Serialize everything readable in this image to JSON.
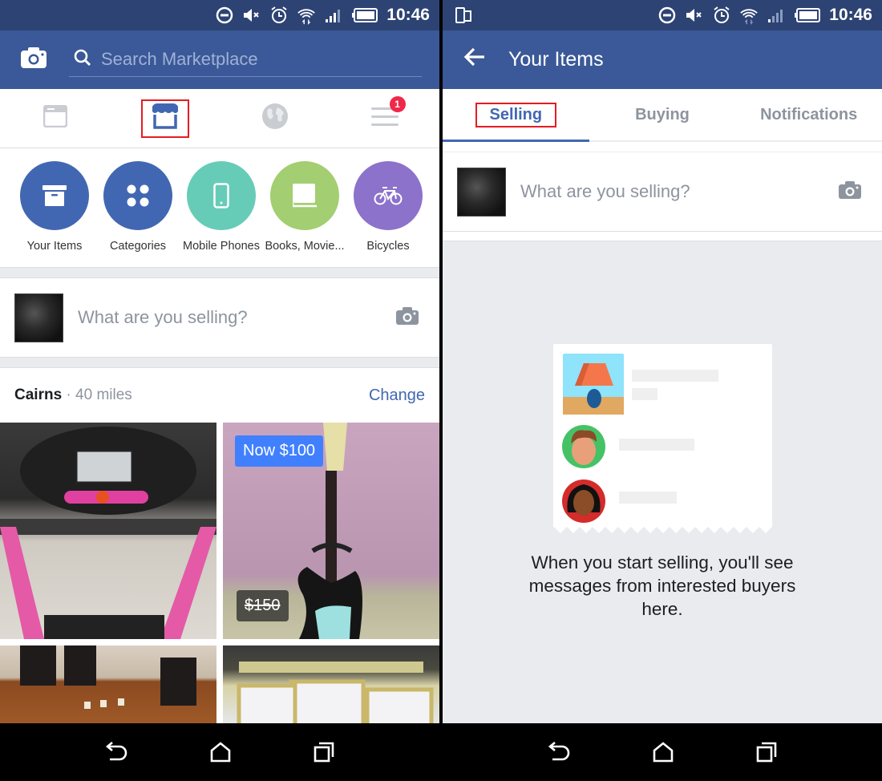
{
  "status_bar": {
    "time": "10:46",
    "icons": [
      "dnd-icon",
      "mute-icon",
      "alarm-icon",
      "wifi-icon",
      "signal-icon",
      "battery-icon"
    ]
  },
  "left": {
    "search": {
      "placeholder": "Search Marketplace"
    },
    "tabs": [
      {
        "name": "feed",
        "icon": "news-feed-icon",
        "active": false
      },
      {
        "name": "marketplace",
        "icon": "marketplace-shop-icon",
        "active": true
      },
      {
        "name": "notifications",
        "icon": "globe-icon",
        "active": false
      },
      {
        "name": "menu",
        "icon": "menu-icon",
        "active": false,
        "badge": "1"
      }
    ],
    "categories": [
      {
        "label": "Your Items",
        "icon": "box-icon",
        "color": "#4267b2"
      },
      {
        "label": "Categories",
        "icon": "dots-grid-icon",
        "color": "#4267b2"
      },
      {
        "label": "Mobile Phones",
        "icon": "phone-icon",
        "color": "#66ccb8"
      },
      {
        "label": "Books, Movie...",
        "icon": "book-icon",
        "color": "#a3ce71"
      },
      {
        "label": "Bicycles",
        "icon": "bicycle-icon",
        "color": "#8c72cb"
      }
    ],
    "composer_placeholder": "What are you selling?",
    "location": {
      "city": "Cairns",
      "separator": " · ",
      "distance": "40 miles",
      "change_label": "Change"
    },
    "listings": [
      {
        "name": "treadmill"
      },
      {
        "name": "guitar",
        "price_now": "Now $100",
        "price_old": "$150"
      },
      {
        "name": "dining-table"
      },
      {
        "name": "frames"
      }
    ]
  },
  "right": {
    "title": "Your Items",
    "tabs": [
      {
        "label": "Selling",
        "active": true
      },
      {
        "label": "Buying",
        "active": false
      },
      {
        "label": "Notifications",
        "active": false
      }
    ],
    "composer_placeholder": "What are you selling?",
    "empty_message": "When you start selling, you'll see messages from interested buyers here."
  },
  "nav": {
    "buttons": [
      "back",
      "home",
      "recents"
    ]
  }
}
